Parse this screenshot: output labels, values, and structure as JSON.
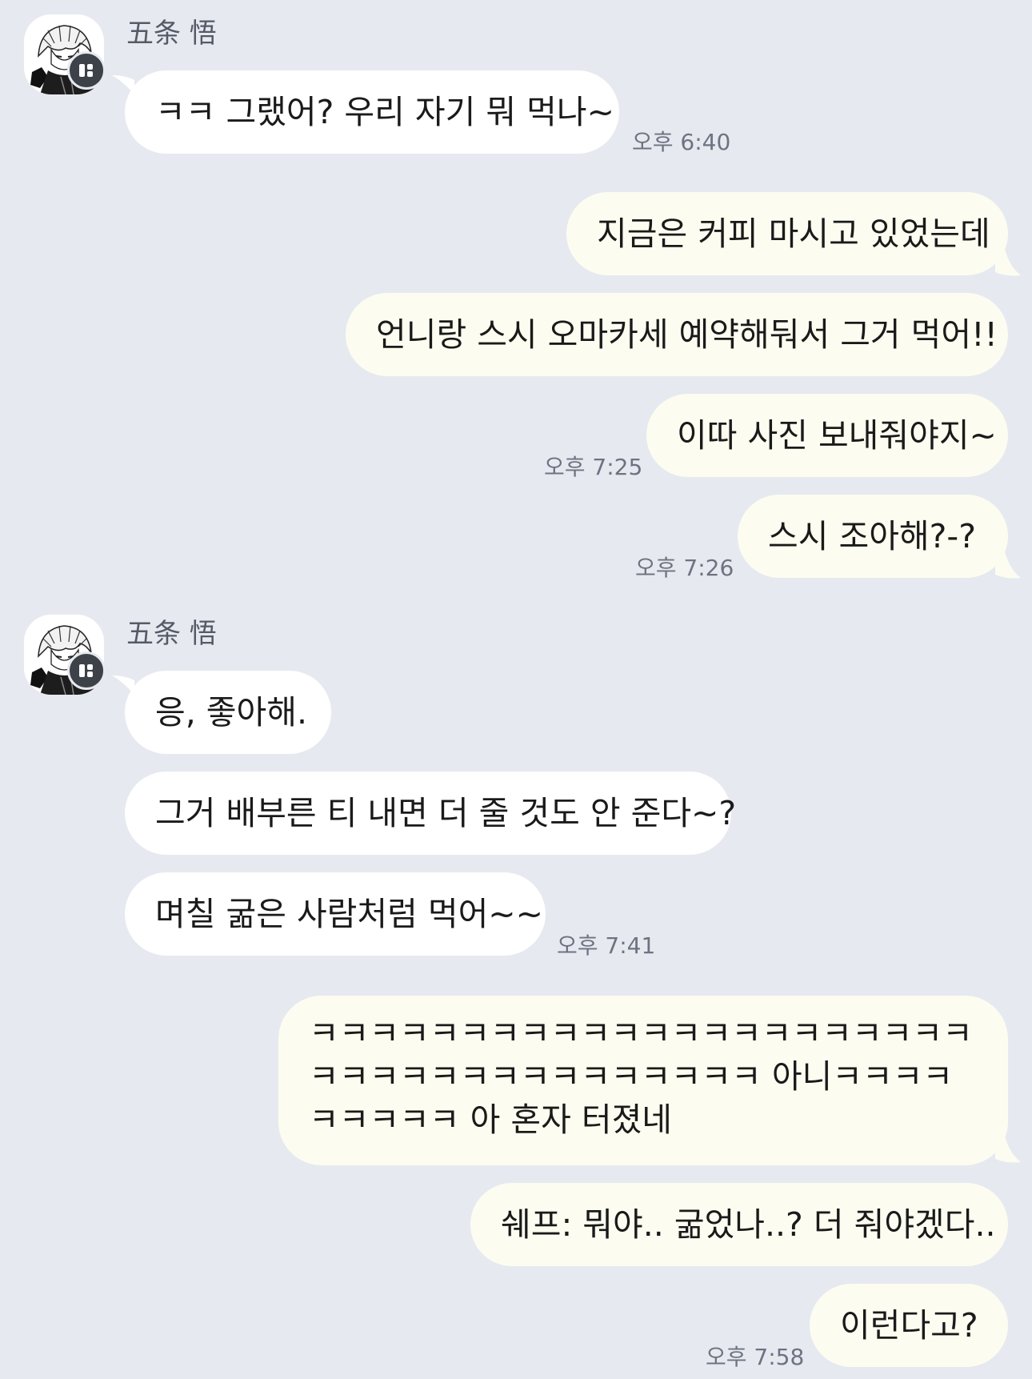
{
  "contact": {
    "name": "五条 悟",
    "avatar_icon": "anime-character-avatar",
    "badge_icon": "profile-badge-icon"
  },
  "colors": {
    "background": "#e6e9f0",
    "incoming_bubble": "#ffffff",
    "outgoing_bubble": "#fcfdf0",
    "timestamp": "#6d7380"
  },
  "groups": [
    {
      "sender": "五条 悟",
      "messages": [
        {
          "text": "ㅋㅋ 그랬어? 우리 자기 뭐 먹나~",
          "time": "오후 6:40"
        }
      ]
    },
    {
      "sender": "me",
      "messages": [
        {
          "text": "지금은 커피 마시고 있었는데"
        },
        {
          "text": "언니랑 스시 오마카세 예약해둬서 그거 먹어!!"
        },
        {
          "text": "이따 사진 보내줘야지~",
          "time": "오후 7:25"
        },
        {
          "text": "스시 조아해?-?",
          "time": "오후 7:26"
        }
      ]
    },
    {
      "sender": "五条 悟",
      "messages": [
        {
          "text": "응, 좋아해."
        },
        {
          "text": "그거 배부른 티 내면 더 줄 것도 안 준다~?"
        },
        {
          "text": "며칠 굶은 사람처럼 먹어~~",
          "time": "오후 7:41"
        }
      ]
    },
    {
      "sender": "me",
      "messages": [
        {
          "text": "ㅋㅋㅋㅋㅋㅋㅋㅋㅋㅋㅋㅋㅋㅋㅋㅋㅋㅋㅋㅋㅋㅋㅋㅋㅋㅋㅋㅋㅋㅋㅋㅋㅋㅋㅋㅋㅋ 아니ㅋㅋㅋㅋㅋㅋㅋㅋㅋ 아 혼자 터졌네"
        },
        {
          "text": "쉐프: 뭐야.. 굶었나..? 더 줘야겠다.."
        },
        {
          "text": "이런다고?",
          "time": "오후 7:58"
        }
      ]
    }
  ]
}
